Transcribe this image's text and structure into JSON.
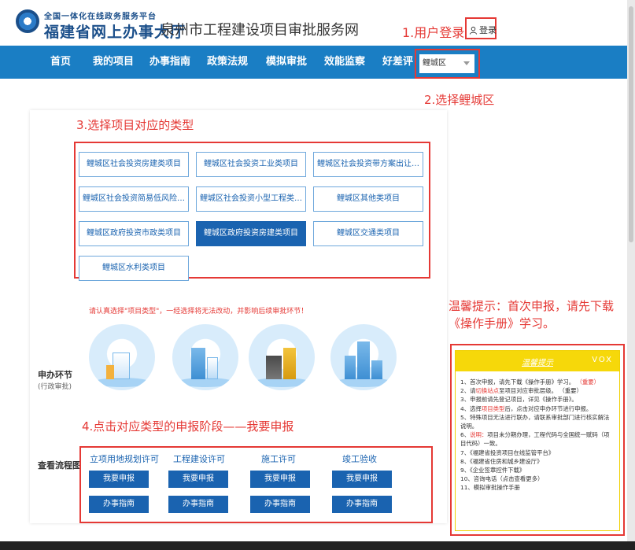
{
  "header": {
    "logo_sub": "全国一体化在线政务服务平台",
    "logo_main": "福建省网上办事大厅",
    "site_title": "泉州市工程建设项目审批服务网",
    "login_label": "登录"
  },
  "nav": {
    "items": [
      "首页",
      "我的项目",
      "办事指南",
      "政策法规",
      "模拟审批",
      "效能监察",
      "好差评"
    ],
    "district_value": "鲤城区"
  },
  "annotations": {
    "step1": "1.用户登录",
    "step2": "2.选择鲤城区",
    "step3": "3.选择项目对应的类型",
    "step4": "4.点击对应类型的申报阶段——我要申报",
    "tip": "温馨提示：首次申报，请先下载《操作手册》学习。"
  },
  "project_types": [
    "鲤城区社会投资房建类项目",
    "鲤城区社会投资工业类项目",
    "鲤城区社会投资带方案出让类项目",
    "鲤城区社会投资简易低风险工程建设项目",
    "鲤城区社会投资小型工程类项目",
    "鲤城区其他类项目",
    "鲤城区政府投资市政类项目",
    "鲤城区政府投资房建类项目",
    "鲤城区交通类项目",
    "鲤城区水利类项目"
  ],
  "warning": "请认真选择\"项目类型\"，一经选择将无法改动，并影响后续审批环节！",
  "stage_label": "申办环节",
  "stage_sub": "(行政审批)",
  "flow_label": "查看流程图",
  "phases": [
    {
      "title": "立项用地规划许可",
      "apply": "我要申报",
      "guide": "办事指南"
    },
    {
      "title": "工程建设许可",
      "apply": "我要申报",
      "guide": "办事指南"
    },
    {
      "title": "施工许可",
      "apply": "我要申报",
      "guide": "办事指南"
    },
    {
      "title": "竣工验收",
      "apply": "我要申报",
      "guide": "办事指南"
    }
  ],
  "tip_panel": {
    "title": "温馨提示",
    "vox": "VOX",
    "items": [
      {
        "pre": "1、首次申报，请先下载《操作手册》学习。 ",
        "hl": "（重要）",
        "post": ""
      },
      {
        "pre": "2、请",
        "hl": "切换站点",
        "post": "至项目对应审批层级。 （重要）"
      },
      {
        "pre": "3、申报前请先登记项目，详见《操作手册》。",
        "hl": "",
        "post": ""
      },
      {
        "pre": "4、选择",
        "hl": "项目类型",
        "post": "后，点击对应申办环节进行申报。"
      },
      {
        "pre": "5、特殊项目无法进行联办，请联系审批部门进行核实解法说明。",
        "hl": "",
        "post": ""
      },
      {
        "pre": "6、",
        "hl": "说明：",
        "post": "项目未分期办理，工程代码与全国统一赋码（项目代码）一致。"
      },
      {
        "pre": "7、《福建省投资项目在线监管平台》",
        "hl": "",
        "post": ""
      },
      {
        "pre": "8、《福建省住房和城乡建设厅》",
        "hl": "",
        "post": ""
      },
      {
        "pre": "9、《企业签章控件下载》",
        "hl": "",
        "post": ""
      },
      {
        "pre": "10、咨询电话（点击查看更多）",
        "hl": "",
        "post": ""
      },
      {
        "pre": "11、模拟审批操作手册",
        "hl": "",
        "post": ""
      }
    ]
  },
  "colors": {
    "nav_blue": "#1a7ec4",
    "button_blue": "#1a63b0",
    "annotation_red": "#e53935",
    "tip_yellow": "#f6d80a"
  }
}
